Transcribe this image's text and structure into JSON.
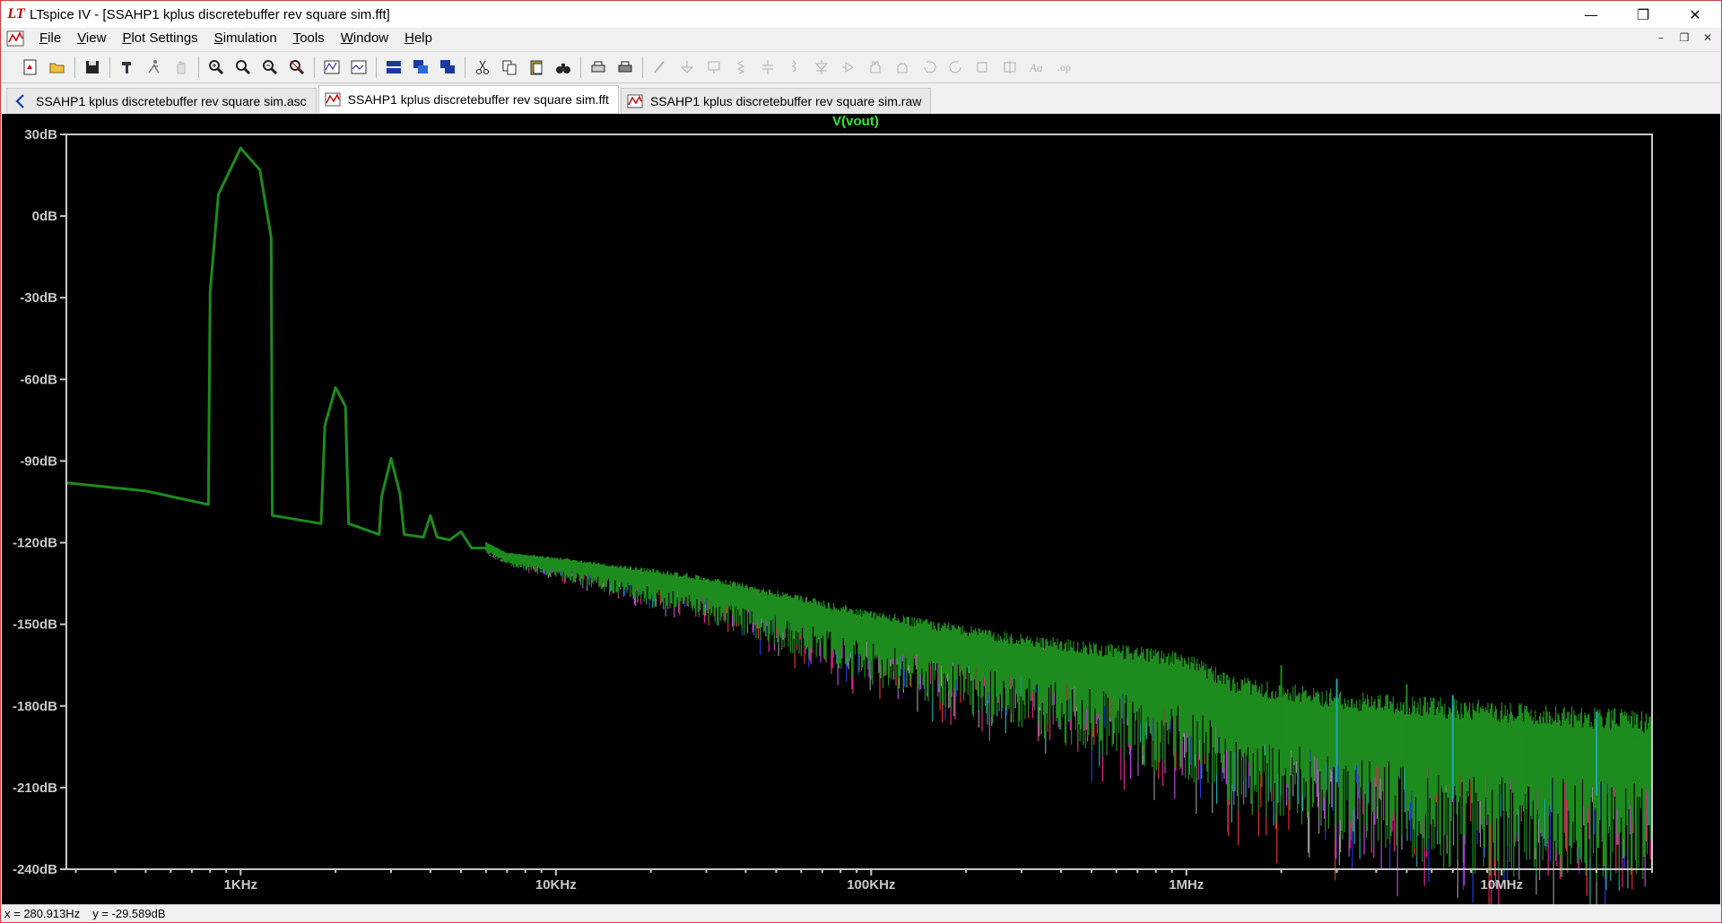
{
  "window": {
    "title": "LTspice IV - [SSAHP1 kplus discretebuffer rev square sim.fft]",
    "logo_text": "LT"
  },
  "menu": {
    "items": [
      "File",
      "View",
      "Plot Settings",
      "Simulation",
      "Tools",
      "Window",
      "Help"
    ]
  },
  "tabs": [
    {
      "label": "SSAHP1 kplus discretebuffer rev square sim.asc",
      "icon": "schematic-icon",
      "active": false
    },
    {
      "label": "SSAHP1 kplus discretebuffer rev square sim.fft",
      "icon": "waveform-icon",
      "active": true
    },
    {
      "label": "SSAHP1 kplus discretebuffer rev square sim.raw",
      "icon": "waveform-icon",
      "active": false
    }
  ],
  "status": {
    "x": "x = 280.913Hz",
    "y": "y = -29.589dB"
  },
  "colors": {
    "trace": "#1d8b1d",
    "trace_title": "#2ee82e",
    "axis": "#c8c8c8",
    "label": "#c8c8c8",
    "noise_colors": [
      "#e0208f",
      "#1e3cd0",
      "#20a8b0",
      "#e03030",
      "#909090",
      "#c040e0"
    ]
  },
  "chart_data": {
    "type": "line",
    "title": "V(vout)",
    "x_scale": "log",
    "y_scale": "dB",
    "xlim": [
      280,
      30000000
    ],
    "ylim": [
      -240,
      30
    ],
    "x_ticks": [
      {
        "value": 1000,
        "label": "1KHz"
      },
      {
        "value": 10000,
        "label": "10KHz"
      },
      {
        "value": 100000,
        "label": "100KHz"
      },
      {
        "value": 1000000,
        "label": "1MHz"
      },
      {
        "value": 10000000,
        "label": "10MHz"
      }
    ],
    "y_ticks": [
      {
        "value": 30,
        "label": "30dB"
      },
      {
        "value": 0,
        "label": "0dB"
      },
      {
        "value": -30,
        "label": "-30dB"
      },
      {
        "value": -60,
        "label": "-60dB"
      },
      {
        "value": -90,
        "label": "-90dB"
      },
      {
        "value": -120,
        "label": "-120dB"
      },
      {
        "value": -150,
        "label": "-150dB"
      },
      {
        "value": -180,
        "label": "-180dB"
      },
      {
        "value": -210,
        "label": "-210dB"
      },
      {
        "value": -240,
        "label": "-240dB"
      }
    ],
    "grid": false,
    "series": [
      {
        "name": "V(vout)",
        "x": [
          280,
          500,
          790,
          800,
          850,
          1000,
          1150,
          1250,
          1260,
          1800,
          1850,
          2000,
          2150,
          2200,
          2750,
          2800,
          3000,
          3200,
          3300,
          3800,
          4000,
          4200,
          4600,
          5000,
          5400,
          6000,
          7000,
          10000,
          30000,
          100000,
          300000,
          1000000,
          1400000,
          2000000,
          3000000,
          5000000,
          30000000
        ],
        "y": [
          -98,
          -101,
          -106,
          -28,
          8,
          25,
          17,
          -8,
          -110,
          -113,
          -77,
          -63,
          -70,
          -113,
          -117,
          -103,
          -89,
          -102,
          -117,
          -118,
          -110,
          -118,
          -119,
          -116,
          -122,
          -122,
          -126,
          -128,
          -136,
          -150,
          -160,
          -168,
          -177,
          -180,
          -183,
          -186,
          -192
        ]
      }
    ]
  }
}
